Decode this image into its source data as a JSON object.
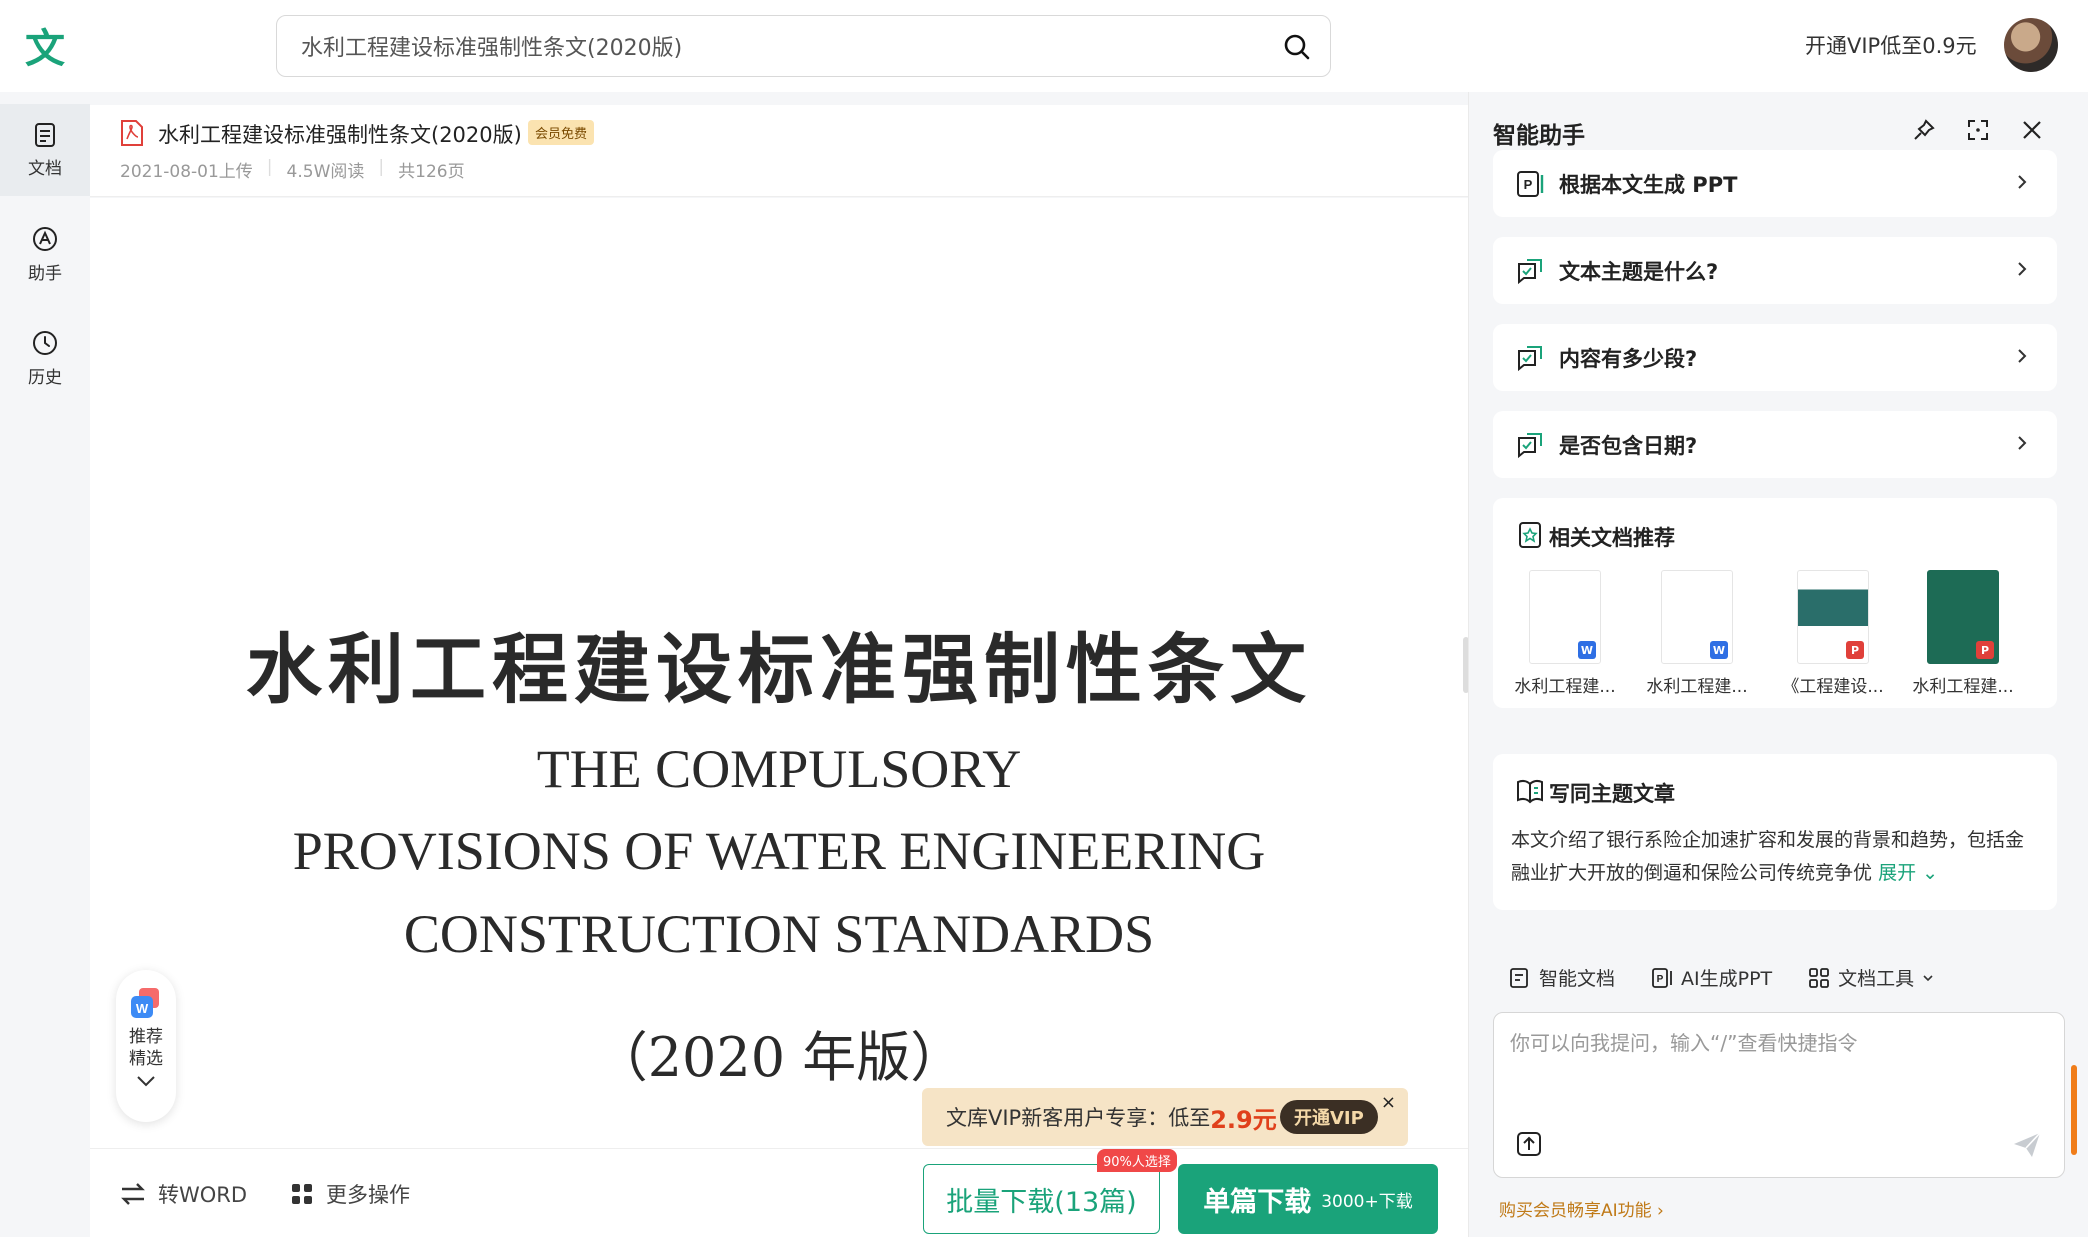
{
  "header": {
    "logo_char": "文",
    "search_query": "水利工程建设标准强制性条文(2020版)",
    "vip_promo": "开通VIP低至0.9元"
  },
  "nav": [
    {
      "label": "文档",
      "icon": "document-icon"
    },
    {
      "label": "助手",
      "icon": "assistant-icon"
    },
    {
      "label": "历史",
      "icon": "history-icon"
    }
  ],
  "doc": {
    "title": "水利工程建设标准强制性条文(2020版)",
    "badge": "会员免费",
    "upload_date": "2021-08-01上传",
    "reads": "4.5W阅读",
    "pages": "共126页"
  },
  "cover": {
    "title_cn": "水利工程建设标准强制性条文",
    "title_en_1": "THE COMPULSORY",
    "title_en_2": "PROVISIONS OF WATER ENGINEERING",
    "title_en_3": "CONSTRUCTION STANDARDS",
    "edition": "（2020 年版）"
  },
  "recommend": {
    "label": "推荐精选"
  },
  "vip_banner": {
    "text": "文库VIP新客用户专享：低至",
    "price": "2.9元",
    "button": "开通VIP",
    "close": "×"
  },
  "bottom": {
    "to_word": "转WORD",
    "more_ops": "更多操作",
    "batch_download": "批量下载(13篇)",
    "batch_tag": "90%人选择",
    "single_download": "单篇下载",
    "single_count": "3000+下载"
  },
  "assistant": {
    "title": "智能助手",
    "questions": [
      {
        "text": "根据本文生成 PPT",
        "icon": "ppt-icon"
      },
      {
        "text": "文本主题是什么?",
        "icon": "chat-check-icon"
      },
      {
        "text": "内容有多少段?",
        "icon": "chat-check-icon"
      },
      {
        "text": "是否包含日期?",
        "icon": "chat-check-icon"
      }
    ],
    "related_title": "相关文档推荐",
    "related_docs": [
      {
        "name": "水利工程建...",
        "type": "W",
        "color": "#2f6fe4"
      },
      {
        "name": "水利工程建...",
        "type": "W",
        "color": "#2f6fe4"
      },
      {
        "name": "《工程建设...",
        "type": "P",
        "color": "#e0403a"
      },
      {
        "name": "水利工程建...",
        "type": "P",
        "color": "#e0403a"
      }
    ],
    "write_title": "写同主题文章",
    "write_body": "本文介绍了银行系险企加速扩容和发展的背景和趋势，包括金融业扩大开放的倒逼和保险公司传统竞争优",
    "expand": "展开",
    "tools": [
      "智能文档",
      "AI生成PPT",
      "文档工具"
    ],
    "input_placeholder": "你可以向我提问，输入“/”查看快捷指令",
    "buy_ai": "购买会员畅享AI功能 ›"
  },
  "colors": {
    "brand": "#1aa37a",
    "price": "#e0401b",
    "accent": "#f07d1a"
  }
}
